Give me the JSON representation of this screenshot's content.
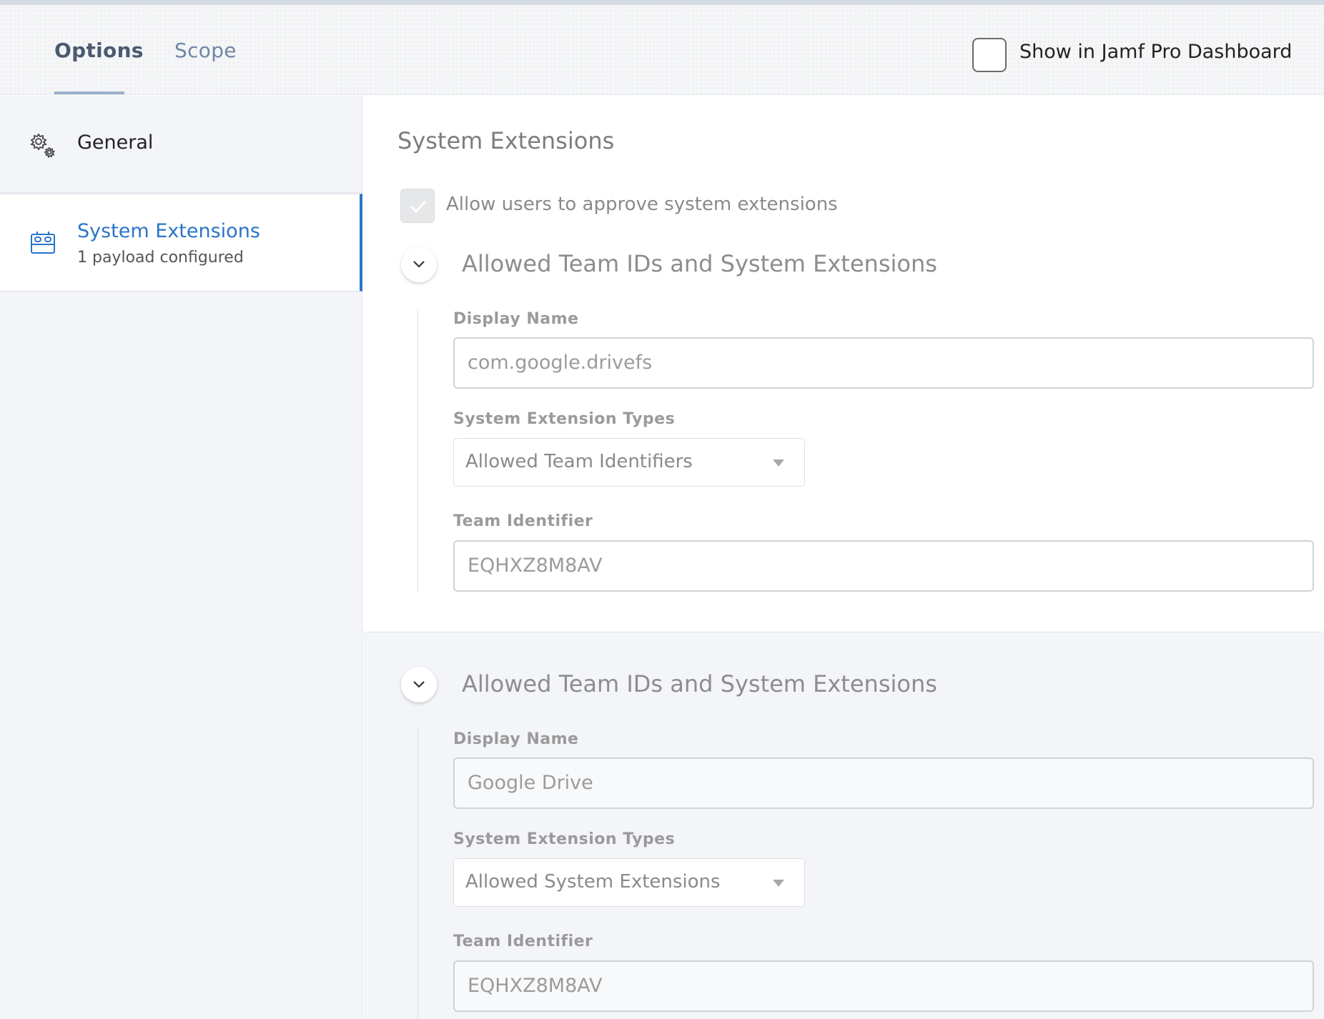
{
  "tabs": {
    "options": "Options",
    "scope": "Scope"
  },
  "dashboard": {
    "label": "Show in Jamf Pro Dashboard",
    "checked": false
  },
  "sidebar": {
    "general_label": "General",
    "system_extensions_label": "System Extensions",
    "system_extensions_sub": "1 payload configured"
  },
  "main": {
    "section_title": "System Extensions",
    "allow_label": "Allow users to approve system extensions",
    "allow_checked": true,
    "groups": [
      {
        "title": "Allowed Team IDs and System Extensions",
        "display_name_label": "Display Name",
        "display_name_value": "com.google.drivefs",
        "types_label": "System Extension Types",
        "types_value": "Allowed Team Identifiers",
        "team_label": "Team Identifier",
        "team_value": "EQHXZ8M8AV"
      },
      {
        "title": "Allowed Team IDs and System Extensions",
        "display_name_label": "Display Name",
        "display_name_value": "Google Drive",
        "types_label": "System Extension Types",
        "types_value": "Allowed System Extensions",
        "team_label": "Team Identifier",
        "team_value": "EQHXZ8M8AV"
      }
    ]
  },
  "colors": {
    "accent": "#2a74c9",
    "tab_active": "#4a5a70",
    "tab_inactive": "#6f86a6",
    "sidebar_bg": "#f3f5f9"
  }
}
